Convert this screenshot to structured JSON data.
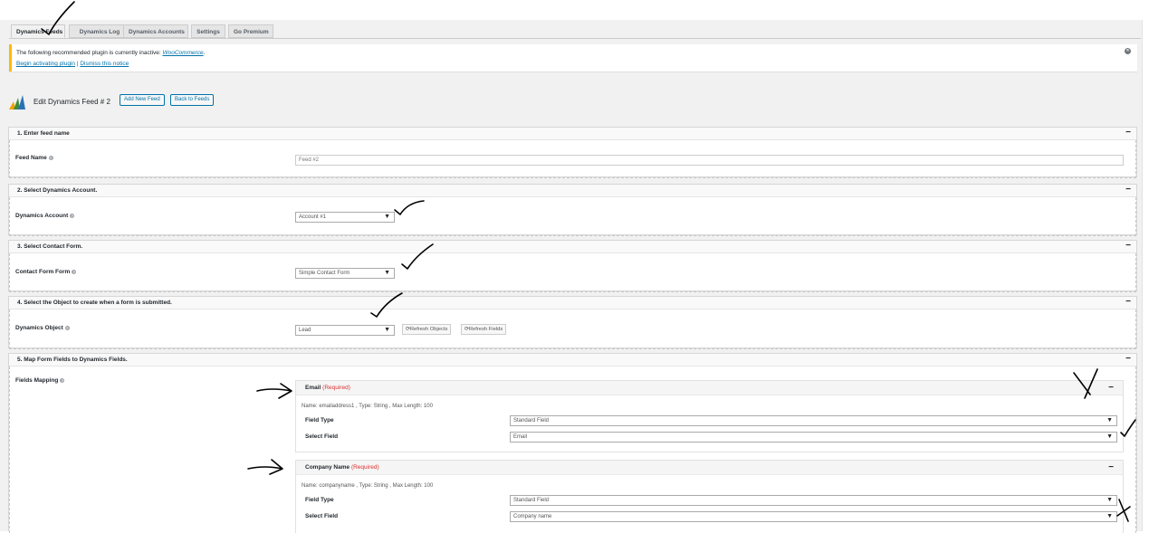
{
  "tabs": [
    "Dynamics Feeds",
    "Dynamics Log",
    "Dynamics Accounts",
    "Settings",
    "Go Premium"
  ],
  "notice": {
    "text": "The following recommended plugin is currently inactive: ",
    "plugin": "WooCommerce",
    "period": ".",
    "activate_link": "Begin activating plugin",
    "separator": " | ",
    "dismiss_link": "Dismiss this notice"
  },
  "header": {
    "title": "Edit Dynamics Feed # 2",
    "add_new_label": "Add New Feed",
    "back_label": "Back to Feeds"
  },
  "sections": {
    "feed_name": {
      "heading": "1. Enter feed name",
      "label": "Feed Name",
      "value": "Feed #2"
    },
    "account": {
      "heading": "2. Select Dynamics Account.",
      "label": "Dynamics Account",
      "value": "Account #1"
    },
    "form": {
      "heading": "3. Select Contact Form.",
      "label": "Contact Form Form",
      "value": "Simple Contact Form"
    },
    "object": {
      "heading": "4. Select the Object to create when a form is submitted.",
      "label": "Dynamics Object",
      "value": "Lead",
      "refresh_objects": "Refresh Objects",
      "refresh_fields": "Refresh Fields"
    },
    "mapping": {
      "heading": "5. Map Form Fields to Dynamics Fields.",
      "label": "Fields Mapping",
      "field_type_label": "Field Type",
      "select_field_label": "Select Field",
      "required_text": "(Required)",
      "fields": [
        {
          "name": "Email",
          "meta": "Name: emailaddress1 , Type: String , Max Length: 100",
          "field_type": "Standard Field",
          "select_field": "Email"
        },
        {
          "name": "Company Name",
          "meta": "Name: companyname , Type: String , Max Length: 100",
          "field_type": "Standard Field",
          "select_field": "Company name"
        }
      ]
    }
  },
  "icons": {
    "collapse": "−",
    "dropdown": "▼",
    "help": "?",
    "refresh": "⟳",
    "dismiss": "×"
  },
  "colors": {
    "link": "#0073aa",
    "notice_warning": "#ffb900",
    "required": "#dc3232"
  }
}
